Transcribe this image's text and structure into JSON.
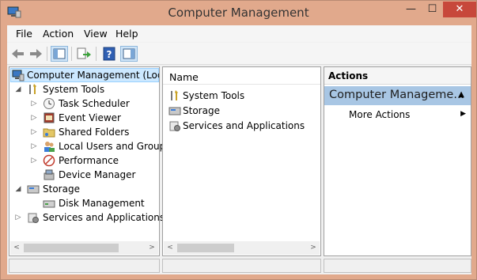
{
  "window": {
    "title": "Computer Management",
    "minimize": "—",
    "maximize": "☐",
    "close": "✕"
  },
  "menu": [
    {
      "label": "File"
    },
    {
      "label": "Action"
    },
    {
      "label": "View"
    },
    {
      "label": "Help"
    }
  ],
  "toolbar": [
    {
      "icon": "back-arrow-icon"
    },
    {
      "icon": "forward-arrow-icon"
    },
    {
      "icon": "show-hide-console-tree-icon"
    },
    {
      "icon": "export-list-icon"
    },
    {
      "icon": "help-icon"
    },
    {
      "icon": "show-hide-action-pane-icon"
    }
  ],
  "tree": {
    "root": "Computer Management (Local)",
    "items": [
      {
        "label": "System Tools",
        "icon": "tools-icon",
        "expander": "◢"
      },
      {
        "label": "Task Scheduler",
        "icon": "clock-icon",
        "expander": "▷"
      },
      {
        "label": "Event Viewer",
        "icon": "event-viewer-icon",
        "expander": "▷"
      },
      {
        "label": "Shared Folders",
        "icon": "shared-folder-icon",
        "expander": "▷"
      },
      {
        "label": "Local Users and Groups",
        "icon": "users-icon",
        "expander": "▷"
      },
      {
        "label": "Performance",
        "icon": "performance-icon",
        "expander": "▷"
      },
      {
        "label": "Device Manager",
        "icon": "device-manager-icon",
        "expander": ""
      },
      {
        "label": "Storage",
        "icon": "storage-icon",
        "expander": "◢"
      },
      {
        "label": "Disk Management",
        "icon": "disk-icon",
        "expander": ""
      },
      {
        "label": "Services and Applications",
        "icon": "services-icon",
        "expander": "▷"
      }
    ]
  },
  "center": {
    "column_header": "Name",
    "items": [
      {
        "label": "System Tools",
        "icon": "tools-icon"
      },
      {
        "label": "Storage",
        "icon": "storage-icon"
      },
      {
        "label": "Services and Applications",
        "icon": "services-icon"
      }
    ]
  },
  "actions": {
    "header": "Actions",
    "section": "Computer Manageme...",
    "collapse_glyph": "▲",
    "items": [
      {
        "label": "More Actions",
        "arrow": "▶"
      }
    ]
  },
  "scroll": {
    "left": "<",
    "right": ">"
  },
  "colors": {
    "title_bar": "#e1a98c",
    "close_button": "#c7483b",
    "selection": "#cce8ff",
    "action_section": "#a8c6e4"
  }
}
